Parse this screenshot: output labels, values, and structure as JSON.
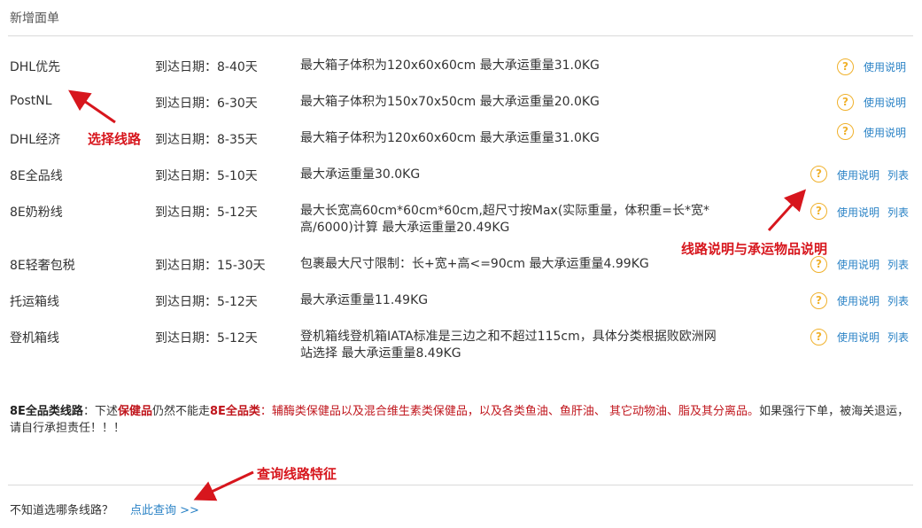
{
  "header": {
    "title": "新增面单"
  },
  "labels": {
    "help": "?",
    "usage": "使用说明",
    "list": "列表"
  },
  "routes": [
    {
      "name": "DHL优先",
      "date": "到达日期：8-40天",
      "desc": "最大箱子体积为120x60x60cm 最大承运重量31.0KG",
      "has_list": false
    },
    {
      "name": "PostNL",
      "date": "到达日期：6-30天",
      "desc": "最大箱子体积为150x70x50cm 最大承运重量20.0KG",
      "has_list": false
    },
    {
      "name": "DHL经济",
      "date": "到达日期：8-35天",
      "desc": "最大箱子体积为120x60x60cm 最大承运重量31.0KG",
      "has_list": false
    },
    {
      "name": "8E全品线",
      "date": "到达日期：5-10天",
      "desc": "最大承运重量30.0KG",
      "has_list": true
    },
    {
      "name": "8E奶粉线",
      "date": "到达日期：5-12天",
      "desc": "最大长宽高60cm*60cm*60cm,超尺寸按Max(实际重量，体积重=长*宽*高/6000)计算 最大承运重量20.49KG",
      "has_list": true
    },
    {
      "name": "8E轻奢包税",
      "date": "到达日期：15-30天",
      "desc": "包裹最大尺寸限制：长+宽+高<=90cm 最大承运重量4.99KG",
      "has_list": true
    },
    {
      "name": "托运箱线",
      "date": "到达日期：5-12天",
      "desc": "最大承运重量11.49KG",
      "has_list": true
    },
    {
      "name": "登机箱线",
      "date": "到达日期：5-12天",
      "desc": "登机箱线登机箱IATA标准是三边之和不超过115cm，具体分类根据败欧洲网站选择 最大承运重量8.49KG",
      "has_list": true
    }
  ],
  "notice": {
    "part1": "8E全品类线路",
    "part2": "：下述",
    "part3": "保健品",
    "part4": "仍然不能走",
    "part5": "8E全品类",
    "part6": "：辅酶类保健品以及混合维生素类保健品，以及各类鱼油、鱼肝油、 其它动物油、脂及其分离品。",
    "part7": "如果强行下单，被海关退运，请自行承担责任！！！"
  },
  "footer": {
    "question": "不知道选哪条线路？",
    "link": "点此查询 >>"
  },
  "annotations": {
    "select_route": "选择线路",
    "route_desc": "线路说明与承运物品说明",
    "query_feature": "查询线路特征"
  },
  "colors": {
    "accent_link": "#2b83c6",
    "help_icon": "#f0b12c",
    "annotation": "#d7161d"
  }
}
